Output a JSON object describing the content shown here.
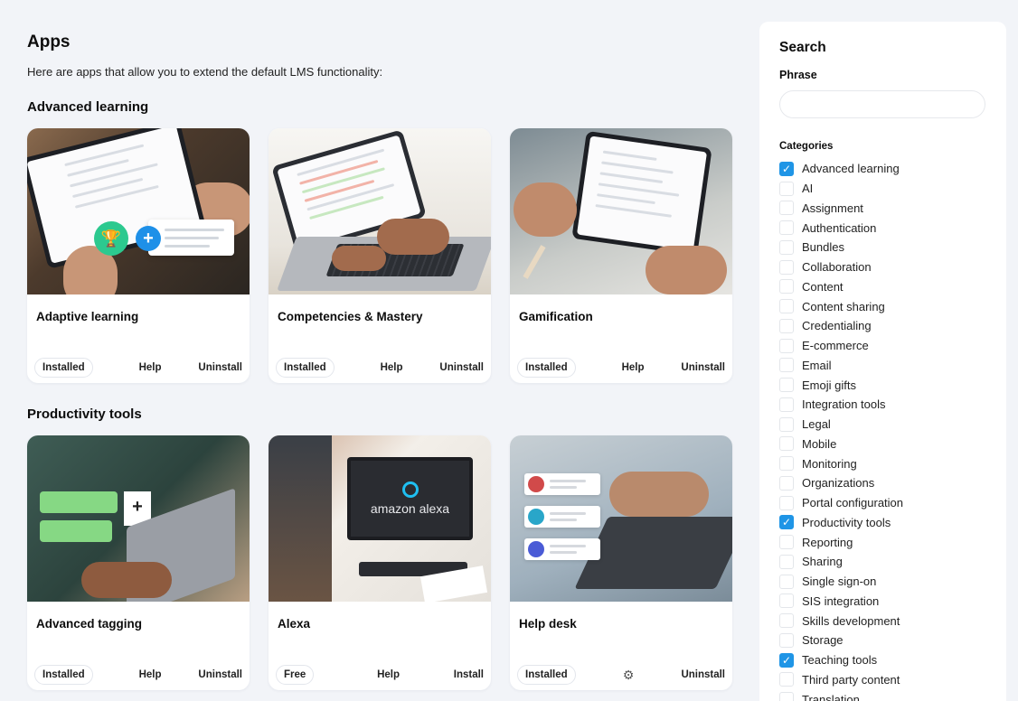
{
  "page": {
    "title": "Apps",
    "description": "Here are apps that allow you to extend the default LMS functionality:"
  },
  "sections": [
    {
      "title": "Advanced learning",
      "cards": [
        {
          "name": "Adaptive learning",
          "badge": "Installed",
          "help": "Help",
          "action": "Uninstall"
        },
        {
          "name": "Competencies & Mastery",
          "badge": "Installed",
          "help": "Help",
          "action": "Uninstall"
        },
        {
          "name": "Gamification",
          "badge": "Installed",
          "help": "Help",
          "action": "Uninstall"
        }
      ]
    },
    {
      "title": "Productivity tools",
      "cards": [
        {
          "name": "Advanced tagging",
          "badge": "Installed",
          "help": "Help",
          "action": "Uninstall"
        },
        {
          "name": "Alexa",
          "badge": "Free",
          "help": "Help",
          "action": "Install",
          "thumb_text": "amazon alexa"
        },
        {
          "name": "Help desk",
          "badge": "Installed",
          "help_icon": "gear-icon",
          "action": "Uninstall"
        }
      ]
    }
  ],
  "sidebar": {
    "title": "Search",
    "phrase_label": "Phrase",
    "phrase_value": "",
    "categories_label": "Categories",
    "accent_color": "#1f95e6",
    "categories": [
      {
        "label": "Advanced learning",
        "checked": true
      },
      {
        "label": "AI",
        "checked": false
      },
      {
        "label": "Assignment",
        "checked": false
      },
      {
        "label": "Authentication",
        "checked": false
      },
      {
        "label": "Bundles",
        "checked": false
      },
      {
        "label": "Collaboration",
        "checked": false
      },
      {
        "label": "Content",
        "checked": false
      },
      {
        "label": "Content sharing",
        "checked": false
      },
      {
        "label": "Credentialing",
        "checked": false
      },
      {
        "label": "E-commerce",
        "checked": false
      },
      {
        "label": "Email",
        "checked": false
      },
      {
        "label": "Emoji gifts",
        "checked": false
      },
      {
        "label": "Integration tools",
        "checked": false
      },
      {
        "label": "Legal",
        "checked": false
      },
      {
        "label": "Mobile",
        "checked": false
      },
      {
        "label": "Monitoring",
        "checked": false
      },
      {
        "label": "Organizations",
        "checked": false
      },
      {
        "label": "Portal configuration",
        "checked": false
      },
      {
        "label": "Productivity tools",
        "checked": true
      },
      {
        "label": "Reporting",
        "checked": false
      },
      {
        "label": "Sharing",
        "checked": false
      },
      {
        "label": "Single sign-on",
        "checked": false
      },
      {
        "label": "SIS integration",
        "checked": false
      },
      {
        "label": "Skills development",
        "checked": false
      },
      {
        "label": "Storage",
        "checked": false
      },
      {
        "label": "Teaching tools",
        "checked": true
      },
      {
        "label": "Third party content",
        "checked": false
      },
      {
        "label": "Translation",
        "checked": false
      }
    ]
  }
}
